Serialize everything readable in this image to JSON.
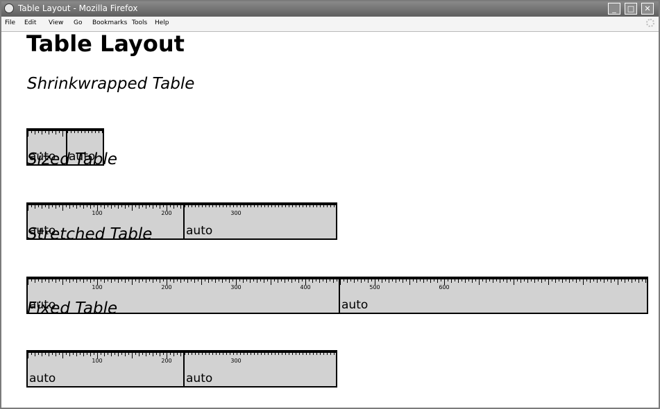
{
  "window": {
    "title": "Table Layout - Mozilla Firefox",
    "buttons": {
      "minimize": "_",
      "maximize": "□",
      "close": "✕"
    }
  },
  "menubar": {
    "items": [
      "File",
      "Edit",
      "View",
      "Go",
      "Bookmarks",
      "Tools",
      "Help"
    ]
  },
  "page": {
    "heading": "Table Layout",
    "sections": [
      {
        "heading": "Shrinkwrapped Table",
        "cells": [
          "auto",
          "auto"
        ],
        "ruler_labels": []
      },
      {
        "heading": "Sized Table",
        "cells": [
          "auto",
          "auto"
        ],
        "ruler_labels": [
          "100",
          "200",
          "300"
        ]
      },
      {
        "heading": "Stretched Table",
        "cells": [
          "auto",
          "auto"
        ],
        "ruler_labels": [
          "100",
          "200",
          "300",
          "400",
          "500",
          "600"
        ]
      },
      {
        "heading": "Fixed Table",
        "cells": [
          "auto",
          "auto"
        ],
        "ruler_labels": [
          "100",
          "200",
          "300"
        ]
      }
    ]
  }
}
